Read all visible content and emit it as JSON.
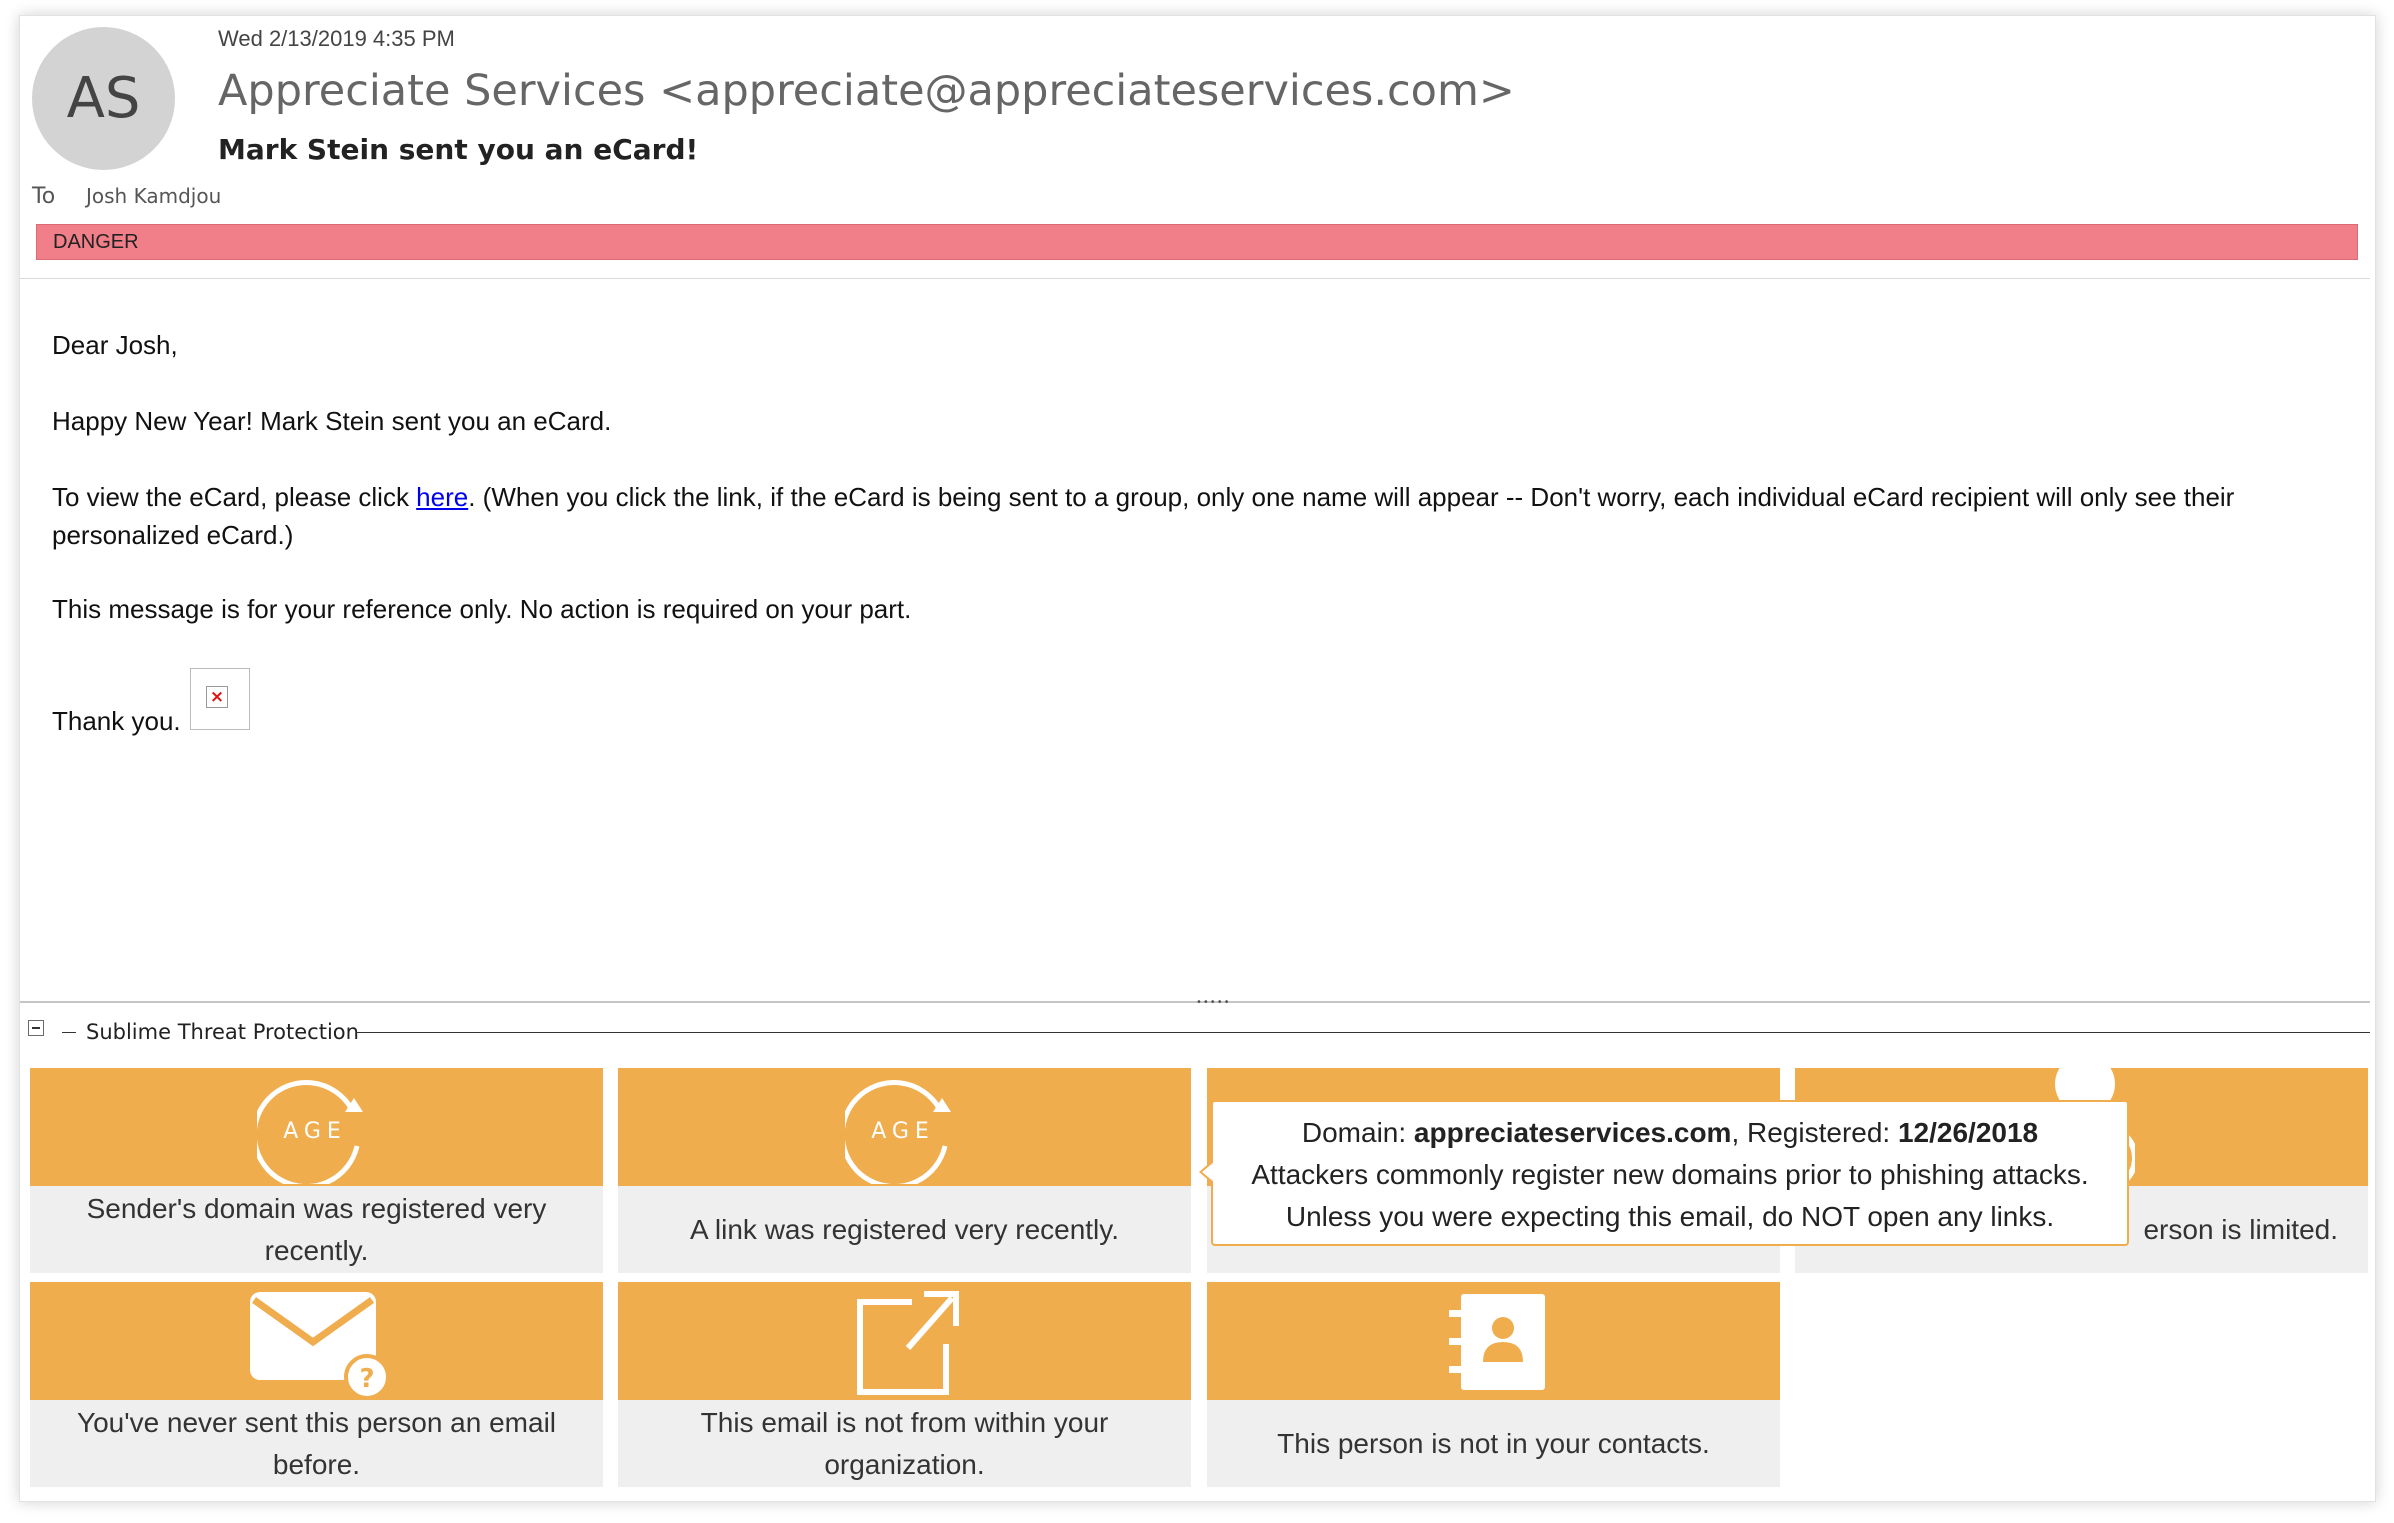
{
  "email": {
    "sender_initials": "AS",
    "date": "Wed 2/13/2019 4:35 PM",
    "from": "Appreciate Services <appreciate@appreciateservices.com>",
    "subject": "Mark Stein sent you an eCard!",
    "to_label": "To",
    "to_name": "Josh Kamdjou",
    "banner": "DANGER",
    "banner_color": "#f07f89"
  },
  "body": {
    "greeting": "Dear Josh,",
    "line1": "Happy New Year! Mark Stein sent you an eCard.",
    "line2_before": "To view the eCard, please click ",
    "line2_link": "here",
    "line2_after": ". (When you click the link, if the eCard is being sent to a group, only one name will appear -- Don't worry, each individual eCard recipient will only see their",
    "line3": "personalized eCard.)",
    "line4": "This message is for your reference only. No action is required on your part.",
    "closing": "Thank you."
  },
  "panel": {
    "title": "Sublime Threat Protection",
    "accent": "#f0ad4e",
    "cards": [
      {
        "label": "Sender's domain was registered very recently.",
        "icon": "age-icon",
        "icon_text": "AGE"
      },
      {
        "label": "A link was registered very recently.",
        "icon": "age-icon",
        "icon_text": "AGE"
      },
      {
        "label": "",
        "icon": ""
      },
      {
        "label": "erson is limited.",
        "icon": "person-icon"
      },
      {
        "label": "You've never sent this person an email before.",
        "icon": "envelope-question-icon"
      },
      {
        "label": "This email is not from within your organization.",
        "icon": "external-link-icon"
      },
      {
        "label": "This person is not in your contacts.",
        "icon": "contacts-book-icon"
      }
    ],
    "tooltip": {
      "domain_prefix": "Domain: ",
      "domain": "appreciateservices.com",
      "registered_prefix": ", Registered: ",
      "registered": "12/26/2018",
      "line2": "Attackers commonly register new domains prior to phishing attacks.",
      "line3": "Unless you were expecting this email, do NOT open any links."
    }
  }
}
